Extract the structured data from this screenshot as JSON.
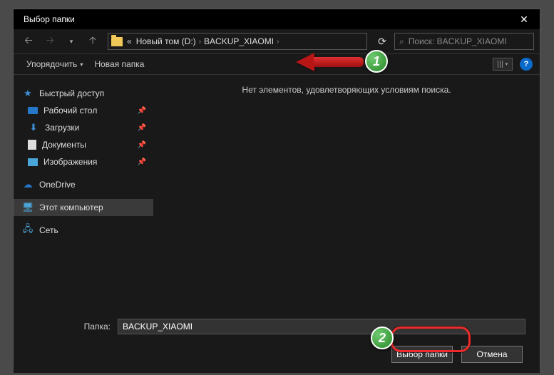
{
  "title": "Выбор папки",
  "breadcrumbs": {
    "pre": "«",
    "seg1": "Новый том (D:)",
    "seg2": "BACKUP_XIAOMI"
  },
  "search": {
    "placeholder": "Поиск: BACKUP_XIAOMI"
  },
  "toolbar": {
    "organize": "Упорядочить",
    "newfolder": "Новая папка"
  },
  "sidebar": {
    "quick": "Быстрый доступ",
    "desktop": "Рабочий стол",
    "downloads": "Загрузки",
    "documents": "Документы",
    "pictures": "Изображения",
    "onedrive": "OneDrive",
    "pc": "Этот компьютер",
    "network": "Сеть"
  },
  "content": {
    "empty": "Нет элементов, удовлетворяющих условиям поиска."
  },
  "footer": {
    "label": "Папка:",
    "value": "BACKUP_XIAOMI",
    "select": "Выбор папки",
    "cancel": "Отмена"
  },
  "annotations": {
    "b1": "1",
    "b2": "2"
  }
}
